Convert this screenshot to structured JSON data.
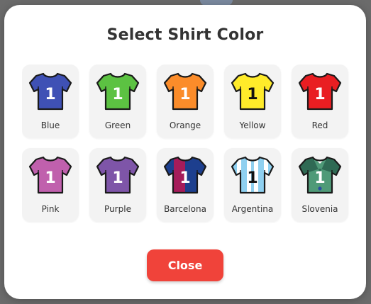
{
  "modal": {
    "title": "Select Shirt Color",
    "close_label": "Close",
    "close_color": "#f0433a"
  },
  "shirt_number": "1",
  "shirts": [
    {
      "label": "Blue",
      "icon": "blue-shirt-icon",
      "color": "#3f51b5",
      "num_color": "#ffffff"
    },
    {
      "label": "Green",
      "icon": "green-shirt-icon",
      "color": "#5cc242",
      "num_color": "#ffffff"
    },
    {
      "label": "Orange",
      "icon": "orange-shirt-icon",
      "color": "#fb8c2a",
      "num_color": "#ffffff"
    },
    {
      "label": "Yellow",
      "icon": "yellow-shirt-icon",
      "color": "#ffeb2a",
      "num_color": "#111111"
    },
    {
      "label": "Red",
      "icon": "red-shirt-icon",
      "color": "#e91e22",
      "num_color": "#ffffff"
    },
    {
      "label": "Pink",
      "icon": "pink-shirt-icon",
      "color": "#c060ad",
      "num_color": "#ffffff"
    },
    {
      "label": "Purple",
      "icon": "purple-shirt-icon",
      "color": "#7e55a8",
      "num_color": "#ffffff"
    },
    {
      "label": "Barcelona",
      "icon": "barcelona-shirt-icon",
      "pattern": "barcelona",
      "color": "#a51c5a",
      "color2": "#1d3f8e",
      "num_color": "#ffffff"
    },
    {
      "label": "Argentina",
      "icon": "argentina-shirt-icon",
      "pattern": "stripes",
      "color": "#ffffff",
      "color2": "#8fd0f0",
      "num_color": "#111111"
    },
    {
      "label": "Slovenia",
      "icon": "slovenia-shirt-icon",
      "pattern": "slovenia",
      "color": "#4f9a78",
      "color2": "#2f6a54",
      "num_color": "#ffffff"
    }
  ]
}
